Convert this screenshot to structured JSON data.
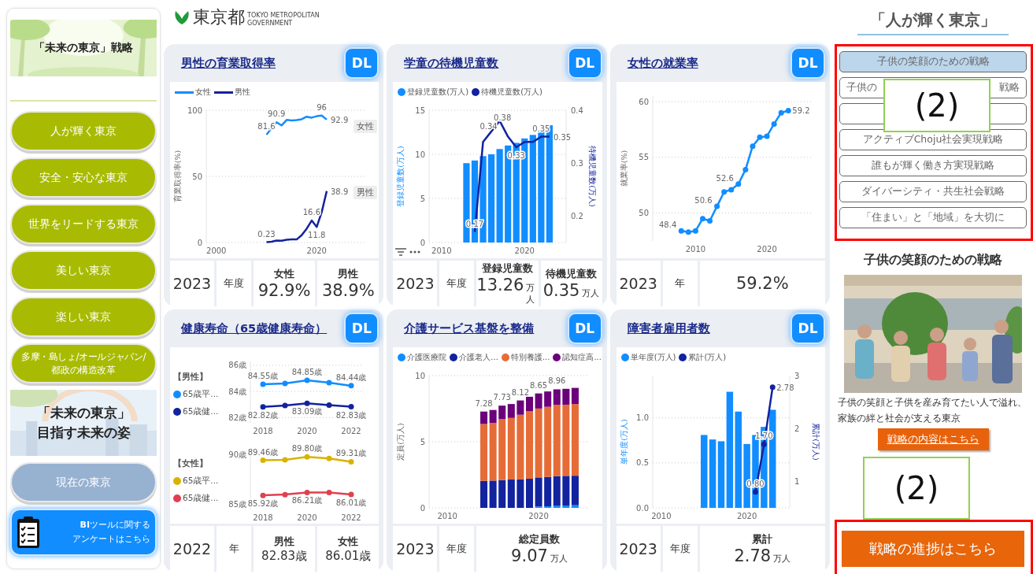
{
  "sidebar": {
    "banner_title": "「未来の東京」戦略",
    "nav": [
      "人が輝く東京",
      "安全・安心な東京",
      "世界をリードする東京",
      "美しい東京",
      "楽しい東京",
      "多摩・島しょ/オールジャパン/\n都政の構造改革"
    ],
    "vision": [
      "「未来の東京」",
      "目指す未来の姿"
    ],
    "current_button": "現在の東京",
    "survey_button": [
      "**BI**ツールに関する",
      "アンケートはこちら"
    ]
  },
  "header": {
    "logo": "東京都",
    "logo_sub": [
      "TOKYO METROPOLITAN",
      "GOVERNMENT"
    ]
  },
  "cards": [
    {
      "title": "男性の育業取得率",
      "dl": "DL",
      "show_legend": true,
      "tags": [
        "女性",
        "男性"
      ],
      "chart_data": {
        "type": "line",
        "ylabel": "育業取得率(%)",
        "grid": true,
        "x": [
          2010,
          2011,
          2012,
          2013,
          2014,
          2015,
          2016,
          2017,
          2018,
          2019,
          2020,
          2021,
          2022
        ],
        "series": [
          {
            "name": "女性",
            "color": "#118dff",
            "values": [
              81.6,
              86.5,
              90.9,
              88.5,
              92.7,
              92.3,
              92.5,
              93.2,
              95.1,
              94.4,
              95.5,
              96,
              92.9
            ]
          },
          {
            "name": "男性",
            "color": "#12239e",
            "values": [
              0.23,
              0.6,
              1.5,
              1.3,
              2.0,
              2.3,
              2.3,
              5.5,
              10.5,
              16.6,
              11.8,
              23.0,
              38.9
            ]
          }
        ],
        "xlim": [
          1998,
          2030
        ],
        "ylim": [
          0,
          100
        ],
        "xticks": [
          2000,
          2020
        ],
        "yticks": [
          0,
          50,
          100
        ],
        "annotations": [
          {
            "x": 2010,
            "y": 81.6,
            "text": "81.6"
          },
          {
            "x": 2012,
            "y": 90.9,
            "text": "90.9"
          },
          {
            "x": 2021,
            "y": 96,
            "text": "96"
          },
          {
            "x": 2022,
            "y": 92.9,
            "text": "92.9"
          },
          {
            "x": 2010,
            "y": 0.23,
            "text": "0.23"
          },
          {
            "x": 2020,
            "y": 11.8,
            "text": "11.8"
          },
          {
            "x": 2019,
            "y": 16.6,
            "text": "16.6"
          },
          {
            "x": 2022,
            "y": 38.9,
            "text": "38.9"
          }
        ]
      },
      "kpi": {
        "year": "2023",
        "unit": "年度",
        "items": [
          {
            "label": "女性",
            "value": "92.9%"
          },
          {
            "label": "男性",
            "value": "38.9%"
          }
        ]
      }
    },
    {
      "title": "学童の待機児童数",
      "dl": "DL",
      "show_legend": true,
      "toolbar": true,
      "chart_data": {
        "type": "bar",
        "ylabel": "登録児童数(万人)",
        "y2label": "待機児童数(万人)",
        "grid": true,
        "x": [
          2013,
          2014,
          2015,
          2016,
          2017,
          2018,
          2019,
          2020,
          2021,
          2022,
          2023
        ],
        "series": [
          {
            "name": "登録児童数(万人)",
            "color": "#118dff",
            "type": "bar",
            "values": [
              9.0,
              9.3,
              9.8,
              10.0,
              10.6,
              11.0,
              11.3,
              11.8,
              12.2,
              12.7,
              13.3
            ]
          },
          {
            "name": "待機児童数(万人)",
            "color": "#12239e",
            "type": "line",
            "axis": "y2",
            "values": [
              null,
              0.17,
              0.34,
              0.36,
              0.38,
              0.35,
              0.33,
              0.34,
              0.34,
              0.35,
              0.35
            ]
          }
        ],
        "xlim": [
          2008.5,
          2025
        ],
        "ylim": [
          0,
          15
        ],
        "y2lim": [
          0.15,
          0.4
        ],
        "xticks": [
          2010,
          2020
        ],
        "yticks": [
          0,
          5,
          10,
          15
        ],
        "y2ticks": [
          0.2,
          0.3,
          0.4
        ],
        "annotations": [
          {
            "x": 2014,
            "text": "0.17"
          },
          "0.34",
          "0.38",
          {
            "x": 2019,
            "text": "0.33"
          },
          {
            "x": 2022,
            "text": "0.35"
          },
          {
            "x": 2023,
            "text": "0.35"
          }
        ]
      },
      "kpi": {
        "year": "2023",
        "unit": "年度",
        "items": [
          {
            "label": "登録児童数",
            "value": "13.26",
            "unit": "万人"
          },
          {
            "label": "待機児童数",
            "value": "0.35",
            "unit": "万人"
          }
        ]
      }
    },
    {
      "title": "女性の就業率",
      "dl": "DL",
      "chart_data": {
        "type": "line",
        "ylabel": "就業率(%)",
        "grid": true,
        "x": [
          2008,
          2009,
          2010,
          2011,
          2012,
          2013,
          2014,
          2015,
          2016,
          2017,
          2018,
          2019,
          2020,
          2021,
          2022,
          2023
        ],
        "series": [
          {
            "color": "#118dff",
            "marker": "circle",
            "values": [
              48.4,
              48.3,
              48.4,
              49.5,
              49.3,
              50.6,
              51.9,
              52.1,
              52.6,
              53.9,
              56.0,
              56.8,
              56.9,
              58.0,
              59.0,
              59.2
            ]
          }
        ],
        "xlim": [
          2004,
          2026.5
        ],
        "ylim": [
          47.5,
          60.5
        ],
        "xticks": [
          2010,
          2020
        ],
        "yticks": [
          50,
          55,
          60
        ],
        "annotations": [
          {
            "x": 2008,
            "y": 48.4,
            "text": "48.4"
          },
          {
            "x": 2013,
            "y": 50.6,
            "text": "50.6"
          },
          {
            "x": 2016,
            "y": 52.6,
            "text": "52.6"
          },
          {
            "x": 2023,
            "y": 59.2,
            "text": "59.2"
          }
        ]
      },
      "kpi": {
        "year": "2023",
        "unit": "年",
        "items": [
          {
            "value": "59.2%"
          }
        ]
      }
    },
    {
      "title": "健康寿命（65歳健康寿命）",
      "dl": "DL",
      "groups": [
        {
          "heading": "【男性】",
          "chart_data": {
            "type": "line",
            "grid": true,
            "x": [
              2018,
              2019,
              2020,
              2021,
              2022
            ],
            "series": [
              {
                "name": "65歳平...",
                "color": "#118dff",
                "marker": "circle",
                "values": [
                  84.55,
                  84.62,
                  84.85,
                  84.68,
                  84.44
                ]
              },
              {
                "name": "65歳健...",
                "color": "#12239e",
                "marker": "circle",
                "values": [
                  82.82,
                  82.92,
                  83.09,
                  82.95,
                  82.83
                ]
              }
            ],
            "xlim": [
              2018,
              2022
            ],
            "ylim": [
              81.6,
              86.3
            ],
            "xticks": [
              2018,
              2020,
              2022
            ],
            "yticks": [
              {
                "value": 82,
                "label": "82歳"
              },
              {
                "value": 84,
                "label": "84歳"
              },
              {
                "value": 86,
                "label": "86歳"
              }
            ],
            "annotations": [
              {
                "x": 2018,
                "y": 84.55,
                "text": "84.55歳"
              },
              {
                "x": 2020,
                "y": 84.85,
                "text": "84.85歳"
              },
              {
                "x": 2022,
                "y": 84.44,
                "text": "84.44歳"
              },
              {
                "x": 2018,
                "y": 82.82,
                "text": "82.82歳"
              },
              {
                "x": 2020,
                "y": 83.09,
                "text": "83.09歳"
              },
              {
                "x": 2022,
                "y": 82.83,
                "text": "82.83歳"
              }
            ]
          }
        },
        {
          "heading": "【女性】",
          "chart_data": {
            "type": "line",
            "x": [
              2018,
              2019,
              2020,
              2021,
              2022
            ],
            "series": [
              {
                "name": "65歳平...",
                "color": "#d9b300",
                "marker": "circle",
                "values": [
                  89.46,
                  89.5,
                  89.8,
                  89.65,
                  89.31
                ]
              },
              {
                "name": "65歳健...",
                "color": "#e0404f",
                "marker": "circle",
                "values": [
                  85.92,
                  86.0,
                  86.21,
                  86.2,
                  86.01
                ]
              }
            ],
            "xlim": [
              2018,
              2022
            ],
            "ylim": [
              84.5,
              90.7
            ],
            "xticks": [
              2018,
              2020,
              2022
            ],
            "yticks": [
              {
                "value": 85,
                "label": "85歳"
              },
              {
                "value": 90,
                "label": "90歳"
              }
            ],
            "annotations": [
              {
                "x": 2018,
                "y": 89.46,
                "text": "89.46歳"
              },
              {
                "x": 2020,
                "y": 89.8,
                "text": "89.80歳"
              },
              {
                "x": 2022,
                "y": 89.31,
                "text": "89.31歳"
              },
              {
                "x": 2018,
                "y": 85.92,
                "text": "85.92歳"
              },
              {
                "x": 2020,
                "y": 86.21,
                "text": "86.21歳"
              },
              {
                "x": 2022,
                "y": 86.01,
                "text": "86.01歳"
              }
            ]
          }
        }
      ],
      "kpi": {
        "year": "2022",
        "unit": "年",
        "items": [
          {
            "label": "男性",
            "value": "82.83歳"
          },
          {
            "label": "女性",
            "value": "86.01歳"
          }
        ]
      }
    },
    {
      "title": "介護サービス基盤を整備",
      "dl": "DL",
      "show_legend": true,
      "chart_data": {
        "type": "bar",
        "stacked": true,
        "ylabel": "定員(万人)",
        "grid": true,
        "x": [
          2014,
          2015,
          2016,
          2017,
          2018,
          2019,
          2020,
          2021,
          2022,
          2023,
          2024
        ],
        "series": [
          {
            "name": "介護医療院",
            "color": "#118dff",
            "values": [
              0,
              0,
              0,
              0,
              0,
              0,
              0.1,
              0.12,
              0.15,
              0.18,
              0.2
            ]
          },
          {
            "name": "介護老人...",
            "color": "#12239e",
            "values": [
              2.04,
              2.06,
              2.1,
              2.14,
              2.15,
              2.2,
              2.2,
              2.22,
              2.24,
              2.24,
              2.23
            ]
          },
          {
            "name": "特別養護...",
            "color": "#e66c37",
            "values": [
              4.3,
              4.36,
              4.61,
              4.66,
              4.89,
              5.1,
              5.21,
              5.3,
              5.4,
              5.38,
              5.42
            ]
          },
          {
            "name": "認知症高...",
            "color": "#6b007b",
            "values": [
              0.94,
              0.98,
              1.02,
              1.05,
              1.08,
              1.1,
              1.14,
              1.16,
              1.17,
              1.2,
              1.22
            ]
          }
        ],
        "xlim": [
          2008,
          2025.6
        ],
        "ylim": [
          0,
          10
        ],
        "xticks": [
          2010,
          2020
        ],
        "yticks": [
          0,
          5,
          10
        ],
        "annotations": [
          {
            "x": 2014,
            "y": 7.28,
            "text": "7.28"
          },
          {
            "x": 2016,
            "y": 7.73,
            "text": "7.73"
          },
          {
            "x": 2018,
            "y": 8.12,
            "text": "8.12"
          },
          {
            "x": 2020,
            "y": 8.65,
            "text": "8.65"
          },
          {
            "x": 2022,
            "y": 8.96,
            "text": "8.96"
          }
        ]
      },
      "kpi": {
        "year": "2023",
        "unit": "年度",
        "items": [
          {
            "label": "総定員数",
            "value": "9.07",
            "unit": "万人"
          }
        ]
      }
    },
    {
      "title": "障害者雇用者数",
      "dl": "DL",
      "show_legend": true,
      "chart_data": {
        "type": "bar",
        "ylabel": "単年度(万人)",
        "y2label": "累計(万人)",
        "grid": true,
        "x": [
          2015,
          2016,
          2017,
          2018,
          2019,
          2020,
          2021,
          2022,
          2023
        ],
        "series": [
          {
            "name": "単年度(万人)",
            "color": "#118dff",
            "type": "bar",
            "values": [
              0.81,
              0.76,
              0.74,
              1.29,
              1.07,
              0.71,
              0.81,
              0.9,
              1.09
            ]
          },
          {
            "name": "累計(万人)",
            "color": "#12239e",
            "type": "line",
            "axis": "y2",
            "marker": "circle",
            "values": [
              null,
              null,
              null,
              null,
              null,
              null,
              0.8,
              1.7,
              2.78
            ]
          }
        ],
        "xlim": [
          2009,
          2025
        ],
        "ylim": [
          0,
          1.47
        ],
        "y2lim": [
          0.5,
          3.0
        ],
        "xticks": [
          2010,
          2020
        ],
        "yticks": [
          {
            "value": 0,
            "label": "0.0"
          },
          0.5,
          {
            "value": 1,
            "label": "1.0"
          }
        ],
        "y2ticks": [
          1,
          2,
          3
        ],
        "annotations": [
          {
            "x": 2021,
            "text": "0.80"
          },
          {
            "x": 2022,
            "text": "1.70"
          },
          {
            "x": 2023,
            "text": "2.78"
          }
        ]
      },
      "kpi": {
        "year": "2023",
        "unit": "年度",
        "items": [
          {
            "label": "累計",
            "value": "2.78",
            "unit": "万人"
          }
        ]
      }
    }
  ],
  "right_panel": {
    "heading": "「人が輝く東京」",
    "strategies_highlighted": true,
    "strategies": [
      {
        "label": "子供の笑顔のための戦略",
        "selected": true
      },
      {
        "label_parts": [
          "子供の",
          "戦略"
        ],
        "selected": false
      },
      {
        "selected": false
      },
      {
        "label": "アクティブChoju社会実現戦略",
        "selected": false
      },
      {
        "label": "誰もが輝く働き方実現戦略",
        "selected": false
      },
      {
        "label": "ダイバーシティ・共生社会戦略",
        "selected": false
      },
      {
        "label": "「住まい」と「地域」を大切に",
        "selected": false
      }
    ],
    "detail_title": "子供の笑顔のための戦略",
    "description": "子供の笑顔と子供を産み育てたい人で溢れ、家族の絆と社会が支える東京",
    "detail_button": "戦略の内容はこちら",
    "progress_button": "戦略の進捗はこちら",
    "progress_highlighted": true
  },
  "callouts": [
    {
      "text": "(2)"
    },
    {
      "text": "(2)"
    }
  ]
}
